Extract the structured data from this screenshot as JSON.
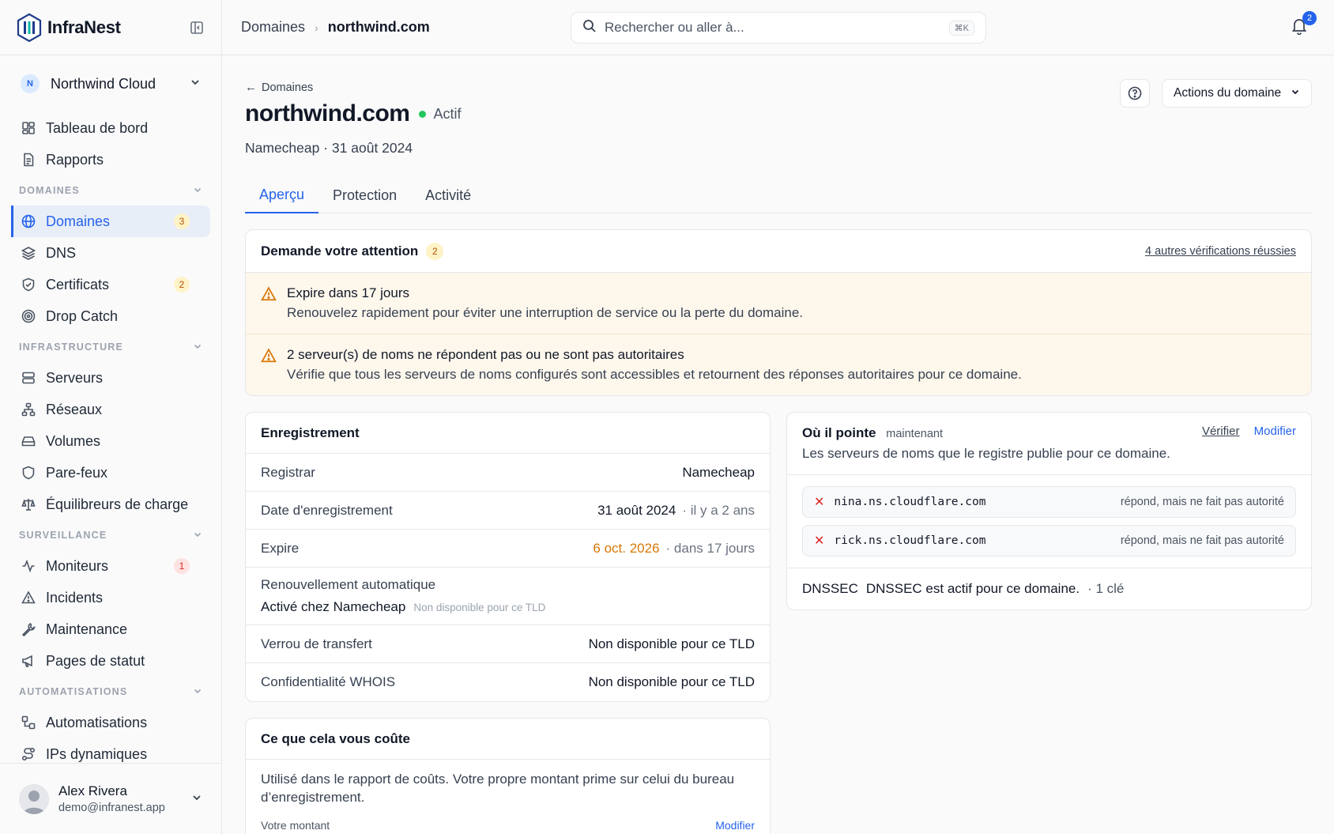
{
  "app": {
    "name": "InfraNest"
  },
  "org": {
    "initial": "N",
    "name": "Northwind Cloud"
  },
  "nav": {
    "top": [
      {
        "label": "Tableau de bord",
        "icon": "dashboard-icon"
      },
      {
        "label": "Rapports",
        "icon": "report-icon"
      }
    ],
    "sections": [
      {
        "title": "DOMAINES",
        "items": [
          {
            "label": "Domaines",
            "icon": "globe-icon",
            "badge": "3",
            "badge_color": "amber",
            "active": true
          },
          {
            "label": "DNS",
            "icon": "layers-icon"
          },
          {
            "label": "Certificats",
            "icon": "shield-check-icon",
            "badge": "2",
            "badge_color": "amber"
          },
          {
            "label": "Drop Catch",
            "icon": "target-icon"
          }
        ]
      },
      {
        "title": "INFRASTRUCTURE",
        "items": [
          {
            "label": "Serveurs",
            "icon": "server-icon"
          },
          {
            "label": "Réseaux",
            "icon": "network-icon"
          },
          {
            "label": "Volumes",
            "icon": "drive-icon"
          },
          {
            "label": "Pare-feux",
            "icon": "shield-icon"
          },
          {
            "label": "Équilibreurs de charge",
            "icon": "scale-icon"
          }
        ]
      },
      {
        "title": "SURVEILLANCE",
        "items": [
          {
            "label": "Moniteurs",
            "icon": "activity-icon",
            "badge": "1",
            "badge_color": "red"
          },
          {
            "label": "Incidents",
            "icon": "alert-triangle-icon"
          },
          {
            "label": "Maintenance",
            "icon": "wrench-icon"
          },
          {
            "label": "Pages de statut",
            "icon": "megaphone-icon"
          }
        ]
      },
      {
        "title": "AUTOMATISATIONS",
        "items": [
          {
            "label": "Automatisations",
            "icon": "workflow-icon"
          },
          {
            "label": "IPs dynamiques",
            "icon": "route-icon"
          }
        ]
      }
    ]
  },
  "user": {
    "name": "Alex Rivera",
    "email": "demo@infranest.app"
  },
  "topbar": {
    "crumb_parent": "Domaines",
    "crumb_current": "northwind.com",
    "search_placeholder": "Rechercher ou aller à...",
    "search_shortcut": "⌘K",
    "notifications_count": "2"
  },
  "page": {
    "back_label": "Domaines",
    "title": "northwind.com",
    "status": "Actif",
    "subtitle": "Namecheap · 31 août 2024",
    "actions_label": "Actions du domaine",
    "tabs": [
      "Aperçu",
      "Protection",
      "Activité"
    ],
    "active_tab": 0
  },
  "attention": {
    "title": "Demande votre attention",
    "count": "2",
    "link": "4 autres vérifications réussies",
    "items": [
      {
        "title": "Expire dans 17 jours",
        "desc": "Renouvelez rapidement pour éviter une interruption de service ou la perte du domaine."
      },
      {
        "title": "2 serveur(s) de noms ne répondent pas ou ne sont pas autoritaires",
        "desc": "Vérifie que tous les serveurs de noms configurés sont accessibles et retournent des réponses autoritaires pour ce domaine."
      }
    ]
  },
  "registration": {
    "title": "Enregistrement",
    "registrar_label": "Registrar",
    "registrar_value": "Namecheap",
    "date_label": "Date d'enregistrement",
    "date_value": "31 août 2024",
    "date_rel": "· il y a 2 ans",
    "expire_label": "Expire",
    "expire_value": "6 oct. 2026",
    "expire_rel": "· dans 17 jours",
    "renew_label": "Renouvellement automatique",
    "renew_value": "Activé chez Namecheap",
    "renew_note": "Non disponible pour ce TLD",
    "lock_label": "Verrou de transfert",
    "lock_value": "Non disponible pour ce TLD",
    "whois_label": "Confidentialité WHOIS",
    "whois_value": "Non disponible pour ce TLD"
  },
  "points": {
    "title": "Où il pointe",
    "now": "maintenant",
    "desc": "Les serveurs de noms que le registre publie pour ce domaine.",
    "verify": "Vérifier",
    "edit": "Modifier",
    "nameservers": [
      {
        "host": "nina.ns.cloudflare.com",
        "status": "répond, mais ne fait pas autorité"
      },
      {
        "host": "rick.ns.cloudflare.com",
        "status": "répond, mais ne fait pas autorité"
      }
    ],
    "dnssec_label": "DNSSEC",
    "dnssec_text": "DNSSEC est actif pour ce domaine.",
    "dnssec_keys": "· 1 clé"
  },
  "cost": {
    "title": "Ce que cela vous coûte",
    "desc": "Utilisé dans le rapport de coûts. Votre propre montant prime sur celui du bureau d’enregistrement.",
    "amount_label": "Votre montant",
    "edit": "Modifier"
  },
  "colors": {
    "accent": "#2563eb",
    "warning": "#d97706",
    "success": "#22c55e",
    "danger": "#dc2626"
  }
}
